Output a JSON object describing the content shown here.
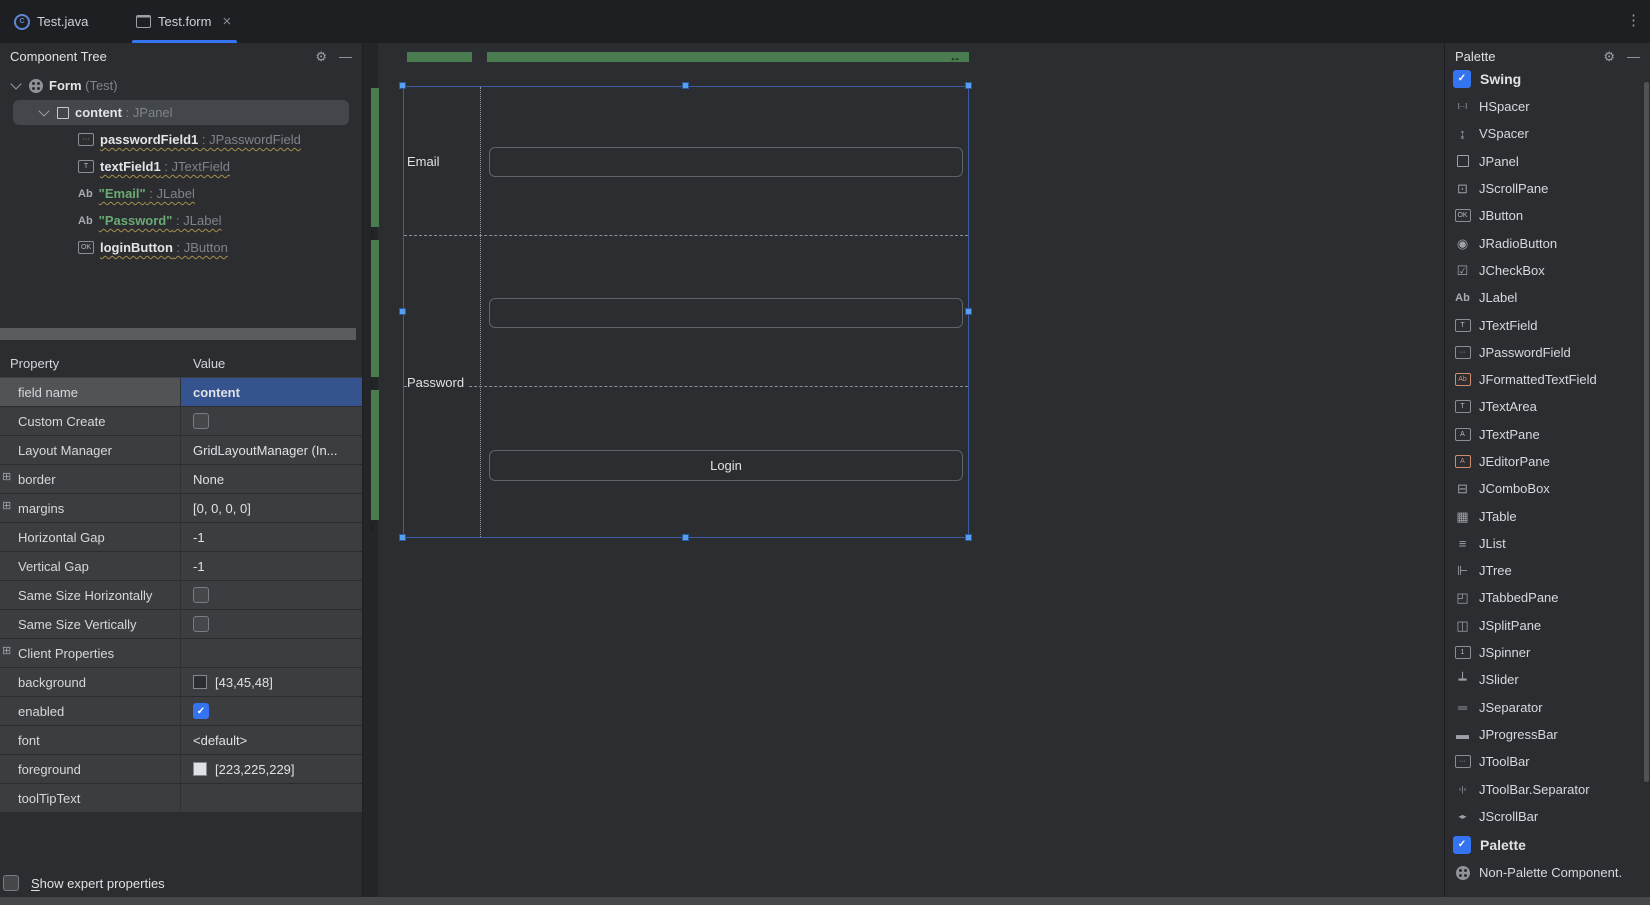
{
  "tab_bar": {
    "tabs": [
      {
        "label": "Test.java",
        "icon": "java-class",
        "active": false
      },
      {
        "label": "Test.form",
        "icon": "form-file",
        "active": true,
        "closable": true
      }
    ],
    "close_glyph": "×",
    "overflow_glyph": "⋮"
  },
  "component_tree": {
    "title": "Component Tree",
    "gear_glyph": "⚙",
    "hide_glyph": "—",
    "rows": [
      {
        "level": 0,
        "chevron": true,
        "icon": "form-circle",
        "name": "Form",
        "suffix": "(Test)"
      },
      {
        "level": 1,
        "chevron": true,
        "icon": "panel-square",
        "name": "content",
        "sep": " : ",
        "type": "JPanel",
        "selected": true
      },
      {
        "level": 2,
        "icon": "password-field",
        "name": "passwordField1",
        "sep": " : ",
        "type": "JPasswordField",
        "warn": true
      },
      {
        "level": 2,
        "icon": "text-field",
        "name": "textField1",
        "sep": " : ",
        "type": "JTextField",
        "warn": true
      },
      {
        "level": 2,
        "icon": "label",
        "name": "\"Email\"",
        "sep": " : ",
        "type": "JLabel",
        "warn": true,
        "green": true
      },
      {
        "level": 2,
        "icon": "label",
        "name": "\"Password\"",
        "sep": " : ",
        "type": "JLabel",
        "warn": true,
        "green": true
      },
      {
        "level": 2,
        "icon": "button",
        "name": "loginButton",
        "sep": " : ",
        "type": "JButton",
        "warn": true
      }
    ]
  },
  "properties": {
    "columns": [
      "Property",
      "Value"
    ],
    "expand_glyph": "⊞",
    "check_glyph": "✓",
    "rows": [
      {
        "name": "field name",
        "kind": "text",
        "value": "content",
        "selected": true
      },
      {
        "name": "Custom Create",
        "kind": "checkbox",
        "checked": false
      },
      {
        "name": "Layout Manager",
        "kind": "text",
        "value": "GridLayoutManager (In..."
      },
      {
        "name": "border",
        "kind": "text",
        "value": "None",
        "expandable": true
      },
      {
        "name": "margins",
        "kind": "text",
        "value": "[0, 0, 0, 0]",
        "expandable": true
      },
      {
        "name": "Horizontal Gap",
        "kind": "text",
        "value": "-1"
      },
      {
        "name": "Vertical Gap",
        "kind": "text",
        "value": "-1"
      },
      {
        "name": "Same Size Horizontally",
        "kind": "checkbox",
        "checked": false
      },
      {
        "name": "Same Size Vertically",
        "kind": "checkbox",
        "checked": false
      },
      {
        "name": "Client Properties",
        "kind": "empty",
        "expandable": true
      },
      {
        "name": "background",
        "kind": "color",
        "swatch": "#2b2d30",
        "value": "[43,45,48]"
      },
      {
        "name": "enabled",
        "kind": "checkbox",
        "checked": true
      },
      {
        "name": "font",
        "kind": "text",
        "value": "<default>"
      },
      {
        "name": "foreground",
        "kind": "color",
        "swatch": "#dfe1e5",
        "value": "[223,225,229]"
      },
      {
        "name": "toolTipText",
        "kind": "empty"
      }
    ],
    "footer": {
      "label_mnemonic": "S",
      "label_rest": "how expert properties",
      "checked": false
    }
  },
  "designer": {
    "email_label": "Email",
    "password_label": "Password",
    "login_button": "Login",
    "h_resize_glyph": "↔",
    "v_resize_glyph": "↕"
  },
  "palette": {
    "title": "Palette",
    "gear_glyph": "⚙",
    "hide_glyph": "—",
    "rows": [
      {
        "kind": "group",
        "label": "Swing",
        "checked": true
      },
      {
        "kind": "item",
        "icon": "hspacer",
        "label": "HSpacer"
      },
      {
        "kind": "item",
        "icon": "vspacer",
        "label": "VSpacer"
      },
      {
        "kind": "item",
        "icon": "panel-outline",
        "label": "JPanel"
      },
      {
        "kind": "item",
        "icon": "scrollpane",
        "label": "JScrollPane"
      },
      {
        "kind": "item",
        "icon": "button-ok",
        "label": "JButton"
      },
      {
        "kind": "item",
        "icon": "radio",
        "label": "JRadioButton"
      },
      {
        "kind": "item",
        "icon": "checkbox-glyph",
        "label": "JCheckBox"
      },
      {
        "kind": "item",
        "icon": "label-ab",
        "label": "JLabel"
      },
      {
        "kind": "item",
        "icon": "textfield",
        "label": "JTextField"
      },
      {
        "kind": "item",
        "icon": "passwordfield",
        "label": "JPasswordField"
      },
      {
        "kind": "item",
        "icon": "formattedtextfield",
        "label": "JFormattedTextField"
      },
      {
        "kind": "item",
        "icon": "textarea",
        "label": "JTextArea"
      },
      {
        "kind": "item",
        "icon": "textpane",
        "label": "JTextPane"
      },
      {
        "kind": "item",
        "icon": "editorpane",
        "label": "JEditorPane"
      },
      {
        "kind": "item",
        "icon": "combobox",
        "label": "JComboBox"
      },
      {
        "kind": "item",
        "icon": "table",
        "label": "JTable"
      },
      {
        "kind": "item",
        "icon": "list",
        "label": "JList"
      },
      {
        "kind": "item",
        "icon": "tree",
        "label": "JTree"
      },
      {
        "kind": "item",
        "icon": "tabbedpane",
        "label": "JTabbedPane"
      },
      {
        "kind": "item",
        "icon": "splitpane",
        "label": "JSplitPane"
      },
      {
        "kind": "item",
        "icon": "spinner",
        "label": "JSpinner"
      },
      {
        "kind": "item",
        "icon": "slider",
        "label": "JSlider"
      },
      {
        "kind": "item",
        "icon": "separator",
        "label": "JSeparator"
      },
      {
        "kind": "item",
        "icon": "progressbar",
        "label": "JProgressBar"
      },
      {
        "kind": "item",
        "icon": "toolbar",
        "label": "JToolBar"
      },
      {
        "kind": "item",
        "icon": "toolbarseparator",
        "label": "JToolBar.Separator"
      },
      {
        "kind": "item",
        "icon": "scrollbar",
        "label": "JScrollBar"
      },
      {
        "kind": "group",
        "label": "Palette",
        "checked": true
      },
      {
        "kind": "item",
        "icon": "globe",
        "label": "Non-Palette Component."
      }
    ]
  },
  "colors": {
    "accent_blue": "#3574f0",
    "selection_blue": "#35538f",
    "selected_name_gray": "#515457",
    "grid_green": "#497c4e",
    "warning_underline_yellow": "#a58f4c",
    "string_green": "#6aab73",
    "handle_blue": "#57a0f0",
    "form_border_blue": "#3a5da0",
    "panel_bg": "#2b2d30",
    "tabbar_bg": "#1e1f22",
    "background_value": "[43,45,48]",
    "foreground_value": "[223,225,229]"
  }
}
